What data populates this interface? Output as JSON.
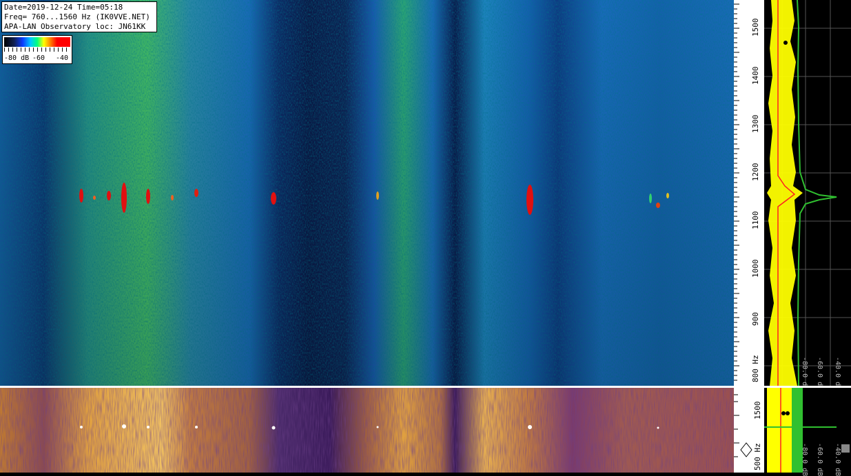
{
  "header": {
    "date_line": "Date=2019-12-24 Time=05:18",
    "freq_line": "Freq= 760...1560 Hz (IK0VVE.NET)",
    "location_line": "APA-LAN Observatory loc: JN61KK"
  },
  "colorbar": {
    "label_low": "-80 dB",
    "label_mid": "-60",
    "label_high": "-40"
  },
  "frequency_scale": {
    "ticks": [
      "1500",
      "1400",
      "1300",
      "1200",
      "1100",
      "1000",
      "900",
      "800 Hz"
    ],
    "bottom_ticks": [
      "1500",
      "500 Hz"
    ]
  },
  "spectrum_panel": {
    "db_labels": [
      "-80.0 dB",
      "-60.0 dB",
      "-40.0 dB"
    ]
  },
  "colors": {
    "background": "#000000",
    "waterfall_low": "#0a1a40",
    "waterfall_mid": "#1a7fd0",
    "waterfall_high": "#30e070",
    "signal": "#e01010",
    "spectrum_trace": "#ffff00",
    "spectrum_avg": "#30c030",
    "spectrum_peak": "#ff2020"
  }
}
